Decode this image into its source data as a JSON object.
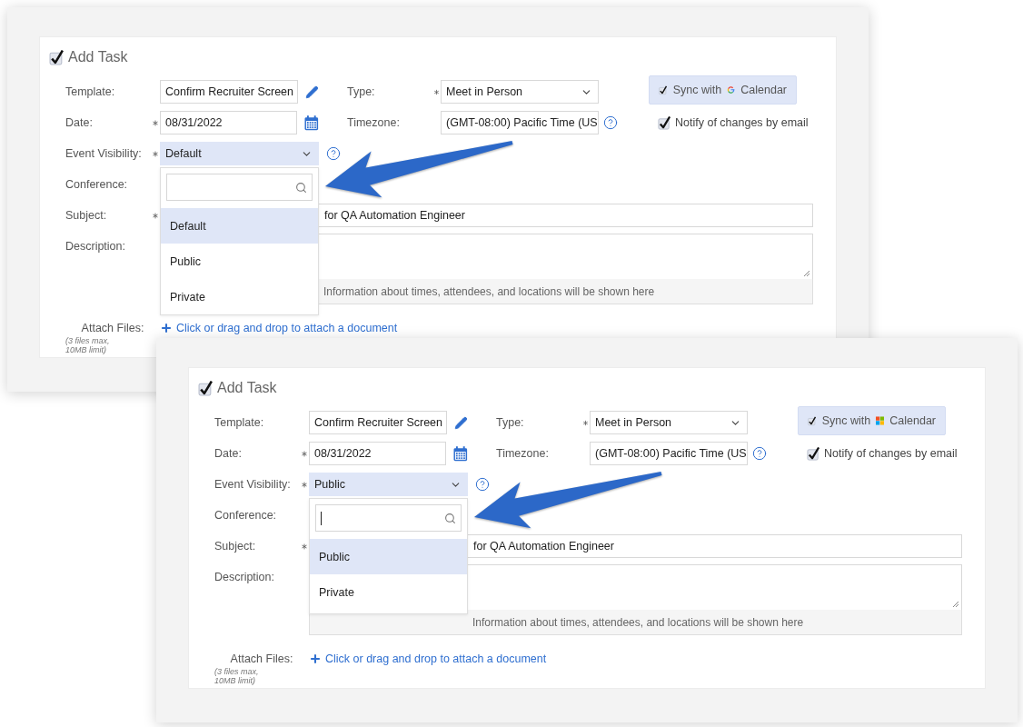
{
  "panels": [
    {
      "title": "Add Task",
      "checked": true,
      "template": {
        "label": "Template:",
        "required": false,
        "value": "Confirm Recruiter Screen"
      },
      "date": {
        "label": "Date:",
        "required": true,
        "value": "08/31/2022"
      },
      "event_visibility": {
        "label": "Event Visibility:",
        "required": true,
        "value": "Default",
        "search": {
          "focused": false
        },
        "options": [
          {
            "label": "Default",
            "selected": true
          },
          {
            "label": "Public",
            "selected": false
          },
          {
            "label": "Private",
            "selected": false
          }
        ]
      },
      "conference": {
        "label": "Conference:"
      },
      "subject": {
        "label": "Subject:",
        "required": true,
        "value": "for QA Automation Engineer"
      },
      "description": {
        "label": "Description:",
        "info": "Information about times, attendees, and locations will be shown here"
      },
      "attach": {
        "label": "Attach Files:",
        "hint": "(3 files max, 10MB limit)",
        "link": "Click or drag and drop to attach a document"
      },
      "type": {
        "label": "Type:",
        "required": true,
        "value": "Meet in Person"
      },
      "timezone": {
        "label": "Timezone:",
        "required": false,
        "value": "(GMT-08:00) Pacific Time (US"
      },
      "sync": {
        "before": "Sync with",
        "after": "Calendar",
        "checked": true,
        "kind": "google"
      },
      "notify": {
        "label": "Notify of changes by email",
        "checked": true
      }
    },
    {
      "title": "Add Task",
      "checked": true,
      "template": {
        "label": "Template:",
        "required": false,
        "value": "Confirm Recruiter Screen"
      },
      "date": {
        "label": "Date:",
        "required": true,
        "value": "08/31/2022"
      },
      "event_visibility": {
        "label": "Event Visibility:",
        "required": true,
        "value": "Public",
        "search": {
          "focused": true
        },
        "options": [
          {
            "label": "Public",
            "selected": true
          },
          {
            "label": "Private",
            "selected": false
          }
        ]
      },
      "conference": {
        "label": "Conference:"
      },
      "subject": {
        "label": "Subject:",
        "required": true,
        "value": "for QA Automation Engineer"
      },
      "description": {
        "label": "Description:",
        "info": "Information about times, attendees, and locations will be shown here"
      },
      "attach": {
        "label": "Attach Files:",
        "hint": "(3 files max, 10MB limit)",
        "link": "Click or drag and drop to attach a document"
      },
      "type": {
        "label": "Type:",
        "required": true,
        "value": "Meet in Person"
      },
      "timezone": {
        "label": "Timezone:",
        "required": false,
        "value": "(GMT-08:00) Pacific Time (US"
      },
      "sync": {
        "before": "Sync with",
        "after": "Calendar",
        "checked": true,
        "kind": "microsoft"
      },
      "notify": {
        "label": "Notify of changes by email",
        "checked": true
      }
    }
  ]
}
